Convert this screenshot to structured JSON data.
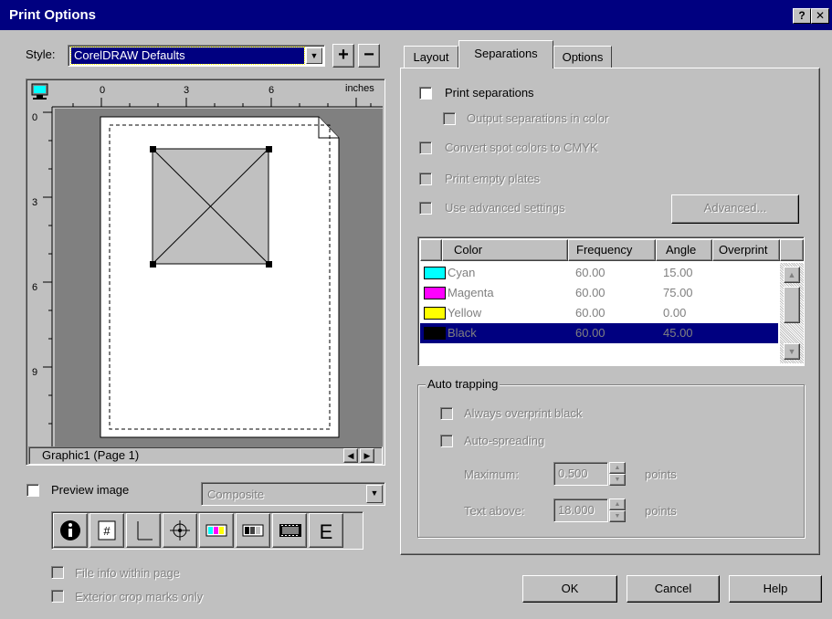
{
  "window": {
    "title": "Print Options",
    "help_glyph": "?",
    "close_glyph": "✕"
  },
  "style": {
    "label": "Style:",
    "value": "CorelDRAW Defaults",
    "add_glyph": "+",
    "remove_glyph": "−"
  },
  "preview": {
    "units_label": "inches",
    "h_ticks": [
      "0",
      "3",
      "6"
    ],
    "v_ticks": [
      "0",
      "3",
      "6",
      "9"
    ],
    "status_text": "Graphic1 (Page 1)",
    "preview_image_label": "Preview image",
    "preview_image_checked": false,
    "mode_value": "Composite"
  },
  "toolbar": {
    "icons": [
      "info-icon",
      "page-number-icon",
      "crop-marks-icon",
      "registration-marks-icon",
      "color-bars-icon",
      "densitometer-icon",
      "film-negative-icon",
      "emulsion-icon"
    ]
  },
  "bottom_options": {
    "file_info": "File info within page",
    "exterior_crop": "Exterior crop marks only"
  },
  "tabs": {
    "items": [
      "Layout",
      "Separations",
      "Options"
    ],
    "active": "Separations"
  },
  "separations": {
    "print_separations": "Print separations",
    "output_in_color": "Output separations in color",
    "convert_spot": "Convert spot colors to CMYK",
    "print_empty": "Print empty plates",
    "use_advanced": "Use advanced settings",
    "advanced_button": "Advanced...",
    "table": {
      "headers": [
        "Color",
        "Frequency",
        "Angle",
        "Overprint"
      ],
      "rows": [
        {
          "color": "Cyan",
          "frequency": "60.00",
          "angle": "15.00",
          "swatch": "#00ffff"
        },
        {
          "color": "Magenta",
          "frequency": "60.00",
          "angle": "75.00",
          "swatch": "#ff00ff"
        },
        {
          "color": "Yellow",
          "frequency": "60.00",
          "angle": "0.00",
          "swatch": "#ffff00"
        },
        {
          "color": "Black",
          "frequency": "60.00",
          "angle": "45.00",
          "swatch": "#000000"
        }
      ],
      "selected_row": 3
    },
    "auto_trapping": {
      "legend": "Auto trapping",
      "always_overprint": "Always overprint black",
      "auto_spreading": "Auto-spreading",
      "maximum_label": "Maximum:",
      "maximum_value": "0.500",
      "maximum_unit": "points",
      "text_above_label": "Text above:",
      "text_above_value": "18.000",
      "text_above_unit": "points"
    }
  },
  "buttons": {
    "ok": "OK",
    "cancel": "Cancel",
    "help": "Help"
  },
  "colors": {
    "titlebar": "#000080",
    "selection": "#000080",
    "face": "#c0c0c0",
    "preview_bg": "#808080"
  }
}
